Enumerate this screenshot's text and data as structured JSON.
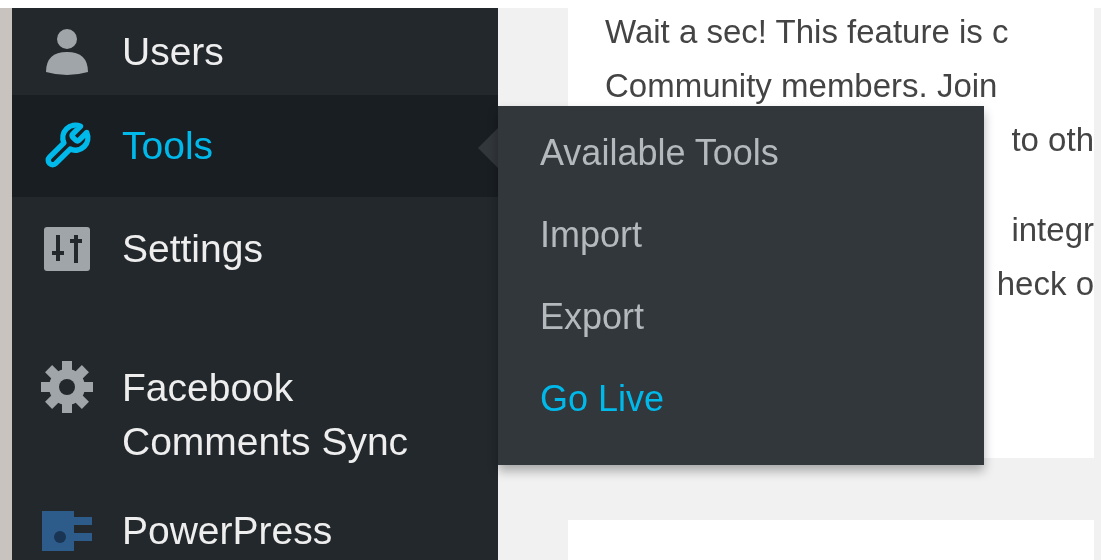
{
  "sidebar": {
    "items": [
      {
        "label": "Users",
        "kind": "user",
        "selected": false
      },
      {
        "label": "Tools",
        "kind": "wrench",
        "selected": true
      },
      {
        "label": "Settings",
        "kind": "sliders",
        "selected": false
      },
      {
        "label": "Facebook Comments Sync",
        "kind": "gear",
        "selected": false
      },
      {
        "label": "PowerPress",
        "kind": "powerpress",
        "selected": false
      }
    ]
  },
  "flyout": {
    "items": [
      {
        "label": "Available Tools",
        "selected": false
      },
      {
        "label": "Import",
        "selected": false
      },
      {
        "label": "Export",
        "selected": false
      },
      {
        "label": "Go Live",
        "selected": true
      }
    ]
  },
  "notice": {
    "lines": [
      {
        "text": "Wait a sec! This feature is c",
        "kind": "full"
      },
      {
        "text": "Community members. Join",
        "kind": "full"
      },
      {
        "text": "to oth",
        "kind": "tail"
      },
      {
        "text": "integr",
        "kind": "tail"
      },
      {
        "text": "heck o",
        "kind": "tail"
      }
    ]
  }
}
